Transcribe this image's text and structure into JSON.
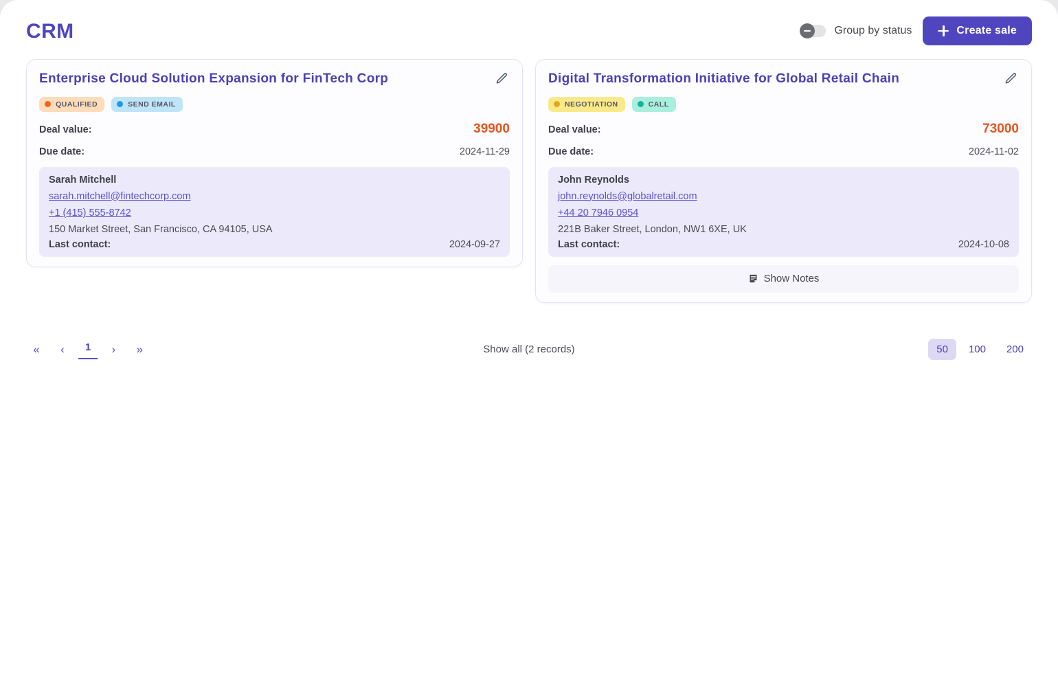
{
  "app": {
    "title": "CRM"
  },
  "header": {
    "toggle_label": "Group by status",
    "toggle_state": "off",
    "create_button": "Create sale",
    "plus_icon": "plus-icon",
    "accent_color": "#4f46bf"
  },
  "cards": [
    {
      "title": "Enterprise Cloud Solution Expansion for FinTech Corp",
      "edit_icon": "pencil-icon",
      "badges": [
        {
          "label": "QUALIFIED",
          "bg": "#fcdcbb",
          "dot": "#f4631e"
        },
        {
          "label": "SEND EMAIL",
          "bg": "#bfe4f8",
          "dot": "#1e9ae0"
        }
      ],
      "deal_value_label": "Deal value:",
      "deal_value": "39900",
      "due_date_label": "Due date:",
      "due_date": "2024-11-29",
      "contact": {
        "name": "Sarah Mitchell",
        "email": "sarah.mitchell@fintechcorp.com",
        "phone": "+1 (415) 555-8742",
        "address": "150 Market Street, San Francisco, CA 94105, USA",
        "last_contact_label": "Last contact:",
        "last_contact": "2024-09-27"
      },
      "show_notes": null
    },
    {
      "title": "Digital Transformation Initiative for Global Retail Chain",
      "edit_icon": "pencil-icon",
      "badges": [
        {
          "label": "NEGOTIATION",
          "bg": "#fae98a",
          "dot": "#e0a81e"
        },
        {
          "label": "CALL",
          "bg": "#a8f0dd",
          "dot": "#19b296"
        }
      ],
      "deal_value_label": "Deal value:",
      "deal_value": "73000",
      "due_date_label": "Due date:",
      "due_date": "2024-11-02",
      "contact": {
        "name": "John Reynolds",
        "email": "john.reynolds@globalretail.com",
        "phone": "+44 20 7946 0954",
        "address": "221B Baker Street, London, NW1 6XE, UK",
        "last_contact_label": "Last contact:",
        "last_contact": "2024-10-08"
      },
      "show_notes": "Show Notes"
    }
  ],
  "pagination": {
    "first_label": "«",
    "prev_label": "‹",
    "current_page": "1",
    "next_label": "›",
    "last_label": "»",
    "show_all": "Show all (2 records)",
    "page_sizes": [
      "50",
      "100",
      "200"
    ],
    "active_size": "50"
  }
}
